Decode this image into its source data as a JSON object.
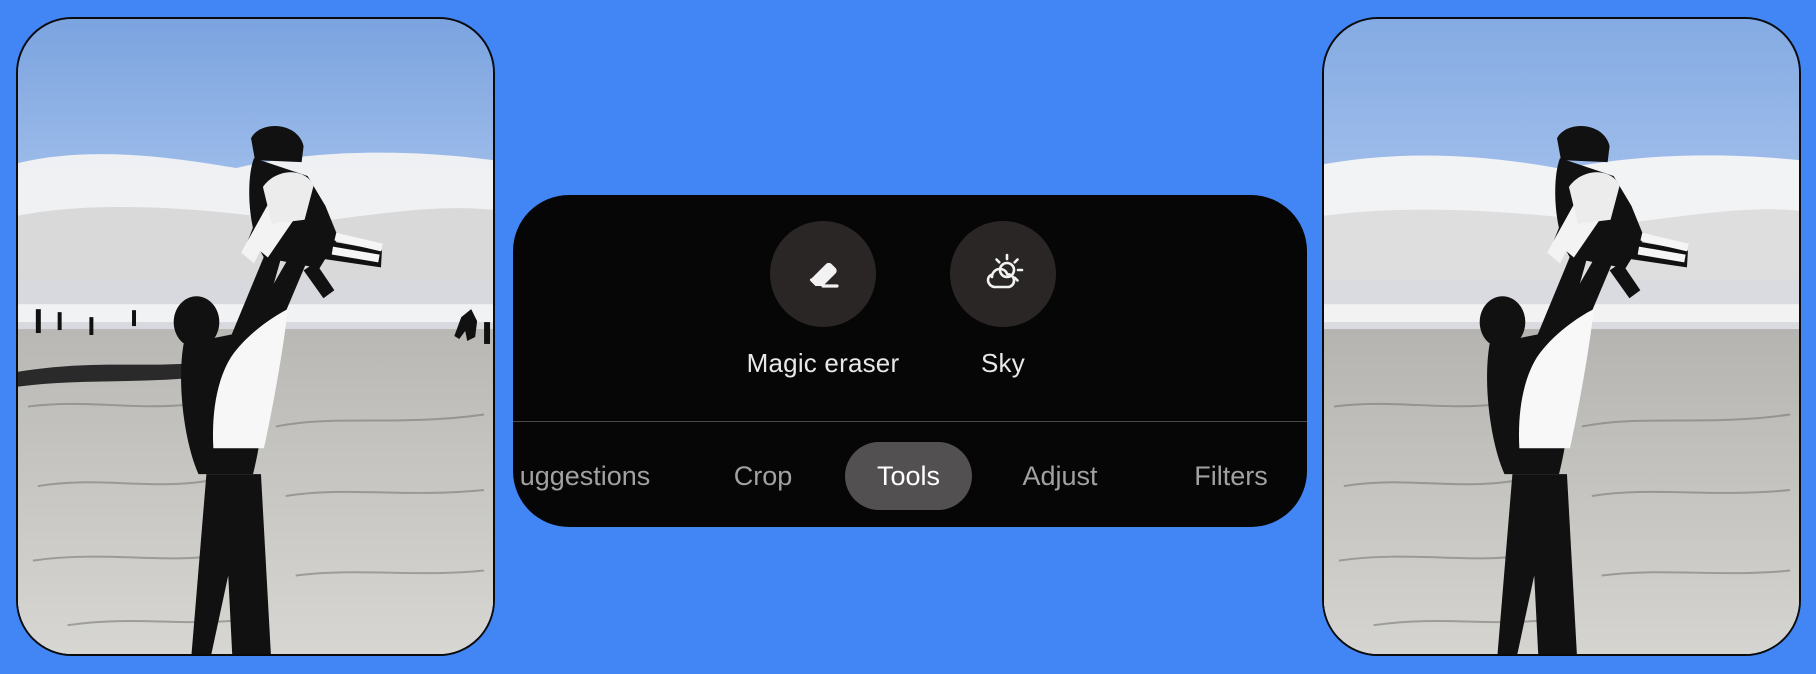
{
  "tools": [
    {
      "label": "Magic eraser",
      "icon": "eraser-icon"
    },
    {
      "label": "Sky",
      "icon": "sun-cloud-icon"
    }
  ],
  "tabs": [
    {
      "label": "uggestions",
      "active": false
    },
    {
      "label": "Crop",
      "active": false
    },
    {
      "label": "Tools",
      "active": true
    },
    {
      "label": "Adjust",
      "active": false
    },
    {
      "label": "Filters",
      "active": false
    }
  ],
  "colors": {
    "background": "#4285f4",
    "panel": "#060606",
    "active_tab": "#535051"
  }
}
